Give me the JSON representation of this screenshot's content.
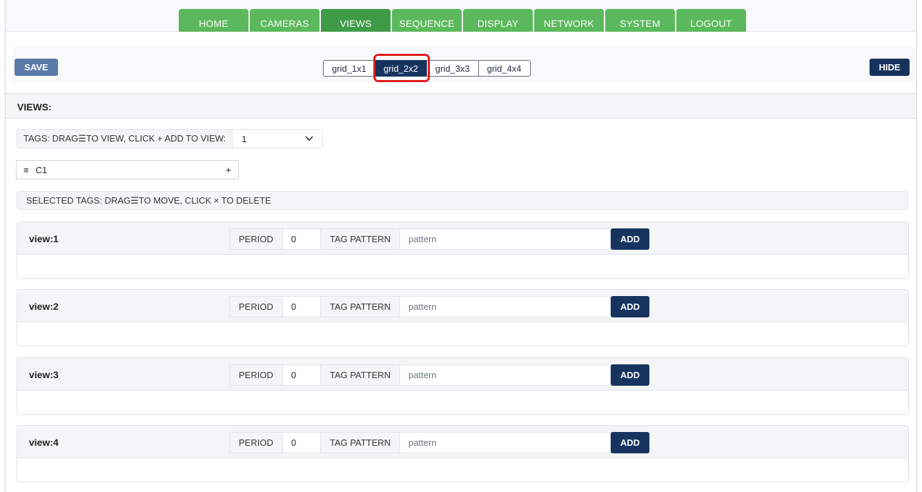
{
  "nav": {
    "tabs": [
      "HOME",
      "CAMERAS",
      "VIEWS",
      "SEQUENCE",
      "DISPLAY",
      "NETWORK",
      "SYSTEM",
      "LOGOUT"
    ],
    "active": "VIEWS"
  },
  "toolbar": {
    "save_label": "SAVE",
    "hide_label": "HIDE",
    "grids": [
      "grid_1x1",
      "grid_2x2",
      "grid_3x3",
      "grid_4x4"
    ],
    "active_grid": "grid_2x2"
  },
  "views_panel": {
    "title": "VIEWS:",
    "tags_label": "TAGS: DRAG☰TO VIEW, CLICK + ADD TO VIEW:",
    "tags_select_value": "1",
    "tag_chip": {
      "drag_icon": "≡",
      "label": "C1",
      "add_icon": "+"
    },
    "selected_label": "SELECTED TAGS: DRAG☰TO MOVE, CLICK × TO DELETE",
    "views": [
      {
        "name": "view:1",
        "period_label": "PERIOD",
        "period": "0",
        "pattern_label": "TAG PATTERN",
        "pattern_placeholder": "pattern",
        "add_label": "ADD"
      },
      {
        "name": "view:2",
        "period_label": "PERIOD",
        "period": "0",
        "pattern_label": "TAG PATTERN",
        "pattern_placeholder": "pattern",
        "add_label": "ADD"
      },
      {
        "name": "view:3",
        "period_label": "PERIOD",
        "period": "0",
        "pattern_label": "TAG PATTERN",
        "pattern_placeholder": "pattern",
        "add_label": "ADD"
      },
      {
        "name": "view:4",
        "period_label": "PERIOD",
        "period": "0",
        "pattern_label": "TAG PATTERN",
        "pattern_placeholder": "pattern",
        "add_label": "ADD"
      }
    ]
  },
  "colors": {
    "nav_green": "#5cb85c",
    "nav_active": "#3f9a47",
    "primary_dark": "#17345f",
    "save_blue": "#5a7aa8",
    "highlight_red": "#e11b1b"
  }
}
